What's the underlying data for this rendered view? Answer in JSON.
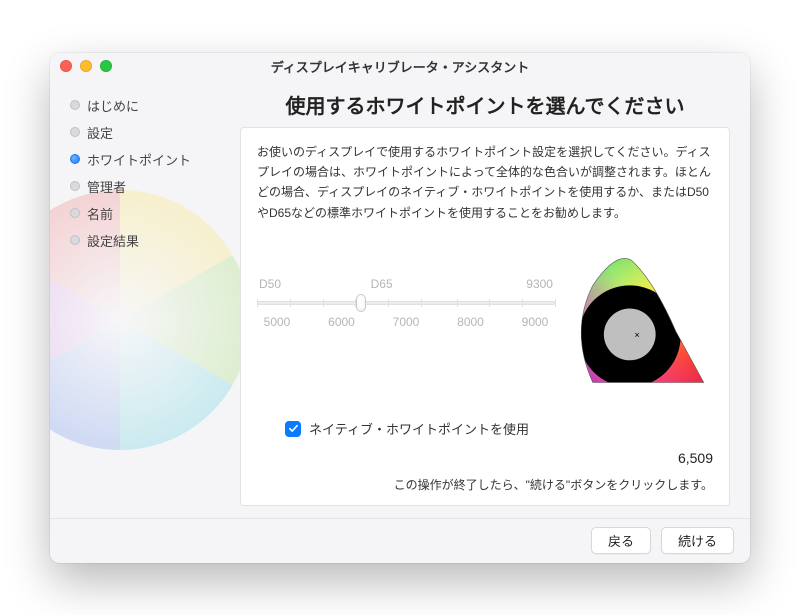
{
  "window": {
    "title": "ディスプレイキャリブレータ・アシスタント"
  },
  "sidebar": {
    "items": [
      {
        "label": "はじめに",
        "active": false
      },
      {
        "label": "設定",
        "active": false
      },
      {
        "label": "ホワイトポイント",
        "active": true
      },
      {
        "label": "管理者",
        "active": false
      },
      {
        "label": "名前",
        "active": false
      },
      {
        "label": "設定結果",
        "active": false
      }
    ]
  },
  "main": {
    "heading": "使用するホワイトポイントを選んでください",
    "description": "お使いのディスプレイで使用するホワイトポイント設定を選択してください。ディスプレイの場合は、ホワイトポイントによって全体的な色合いが調整されます。ほとんどの場合、ディスプレイのネイティブ・ホワイトポイントを使用するか、またはD50やD65などの標準ホワイトポイントを使用することをお勧めします。",
    "slider": {
      "top_labels": [
        "D50",
        "D65",
        "9300"
      ],
      "bottom_labels": [
        "5000",
        "6000",
        "7000",
        "8000",
        "9000"
      ],
      "enabled": false
    },
    "checkbox": {
      "label": "ネイティブ・ホワイトポイントを使用",
      "checked": true
    },
    "value_display": "6,509",
    "hint": "この操作が終了したら、\"続ける\"ボタンをクリックします。"
  },
  "footer": {
    "back_label": "戻る",
    "continue_label": "続ける"
  }
}
